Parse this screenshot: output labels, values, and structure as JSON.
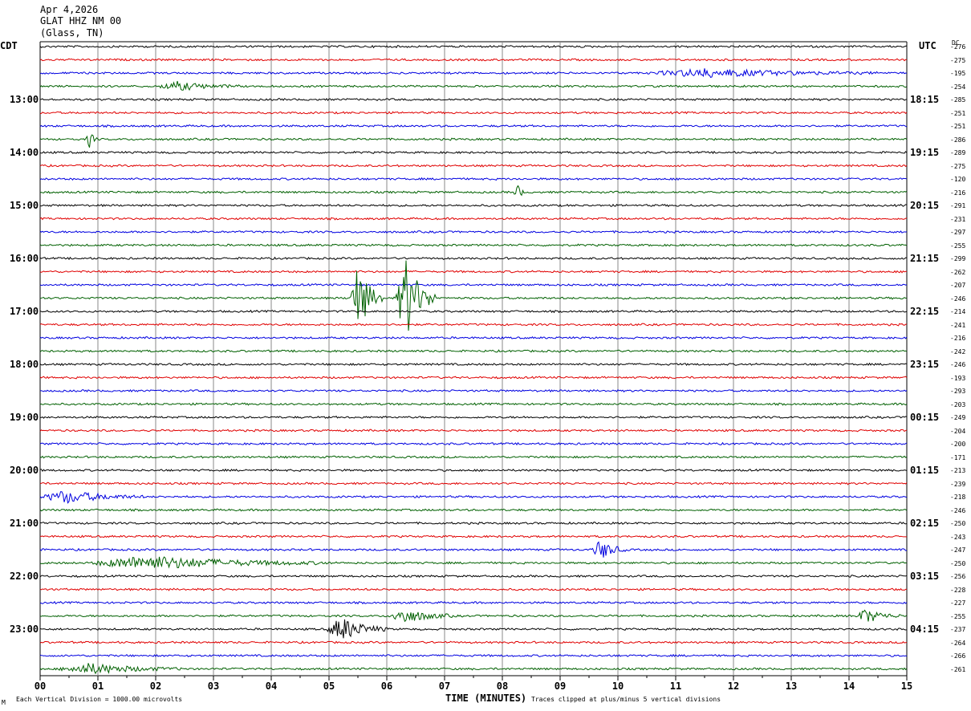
{
  "header": {
    "date": "Apr 4,2026",
    "station": "GLAT HHZ NM 00",
    "location": "(Glass, TN)"
  },
  "left_zone": "CDT",
  "right_zone": "UTC",
  "dc_label": "DC",
  "footer": {
    "scale": "Each Vertical Division = 1000.00 microvolts",
    "clip": "Traces clipped at plus/minus 5 vertical divisions",
    "corner": "M"
  },
  "chart_data": {
    "type": "line",
    "xlabel": "TIME (MINUTES)",
    "xlim": [
      0,
      15
    ],
    "x_ticks": [
      "00",
      "01",
      "02",
      "03",
      "04",
      "05",
      "06",
      "07",
      "08",
      "09",
      "10",
      "11",
      "12",
      "13",
      "14",
      "15"
    ],
    "trace_interval_minutes": 15,
    "trace_count": 48,
    "trace_colors": [
      "#000000",
      "#e00000",
      "#0000e0",
      "#006000"
    ],
    "left_hour_labels": [
      {
        "trace": 4,
        "label": "13:00"
      },
      {
        "trace": 8,
        "label": "14:00"
      },
      {
        "trace": 12,
        "label": "15:00"
      },
      {
        "trace": 16,
        "label": "16:00"
      },
      {
        "trace": 20,
        "label": "17:00"
      },
      {
        "trace": 24,
        "label": "18:00"
      },
      {
        "trace": 28,
        "label": "19:00"
      },
      {
        "trace": 32,
        "label": "20:00"
      },
      {
        "trace": 36,
        "label": "21:00"
      },
      {
        "trace": 40,
        "label": "22:00"
      },
      {
        "trace": 44,
        "label": "23:00"
      }
    ],
    "right_hour_labels": [
      {
        "trace": 4,
        "label": "18:15"
      },
      {
        "trace": 8,
        "label": "19:15"
      },
      {
        "trace": 12,
        "label": "20:15"
      },
      {
        "trace": 16,
        "label": "21:15"
      },
      {
        "trace": 20,
        "label": "22:15"
      },
      {
        "trace": 24,
        "label": "23:15"
      },
      {
        "trace": 28,
        "label": "00:15"
      },
      {
        "trace": 32,
        "label": "01:15"
      },
      {
        "trace": 36,
        "label": "02:15"
      },
      {
        "trace": 40,
        "label": "03:15"
      },
      {
        "trace": 44,
        "label": "04:15"
      }
    ],
    "dc_offsets": [
      "-276",
      "-275",
      "-195",
      "-254",
      "-285",
      "-251",
      "-251",
      "-286",
      "-289",
      "-275",
      "-120",
      "-216",
      "-291",
      "-231",
      "-297",
      "-255",
      "-299",
      "-262",
      "-207",
      "-246",
      "-214",
      "-241",
      "-216",
      "-242",
      "-246",
      "-193",
      "-293",
      "-203",
      "-249",
      "-204",
      "-200",
      "-171",
      "-213",
      "-239",
      "-218",
      "-246",
      "-250",
      "-243",
      "-247",
      "-250",
      "-256",
      "-228",
      "-227",
      "-255",
      "-237",
      "-264",
      "-266",
      "-261"
    ],
    "events": [
      {
        "trace": 19,
        "start": 5.35,
        "end": 5.95,
        "amp": 1.0
      },
      {
        "trace": 19,
        "start": 6.15,
        "end": 6.85,
        "amp": 1.25
      },
      {
        "trace": 2,
        "start": 10.5,
        "end": 14.5,
        "amp": 0.12
      },
      {
        "trace": 3,
        "start": 2.0,
        "end": 3.5,
        "amp": 0.12
      },
      {
        "trace": 7,
        "start": 0.8,
        "end": 1.0,
        "amp": 0.25
      },
      {
        "trace": 11,
        "start": 8.2,
        "end": 8.4,
        "amp": 0.25
      },
      {
        "trace": 34,
        "start": 0.0,
        "end": 1.8,
        "amp": 0.18
      },
      {
        "trace": 38,
        "start": 9.55,
        "end": 10.15,
        "amp": 0.3
      },
      {
        "trace": 39,
        "start": 0.8,
        "end": 5.0,
        "amp": 0.2
      },
      {
        "trace": 43,
        "start": 6.0,
        "end": 7.2,
        "amp": 0.2
      },
      {
        "trace": 43,
        "start": 14.1,
        "end": 14.9,
        "amp": 0.2
      },
      {
        "trace": 44,
        "start": 4.95,
        "end": 6.0,
        "amp": 0.35
      },
      {
        "trace": 47,
        "start": 0.3,
        "end": 2.5,
        "amp": 0.15
      }
    ]
  }
}
